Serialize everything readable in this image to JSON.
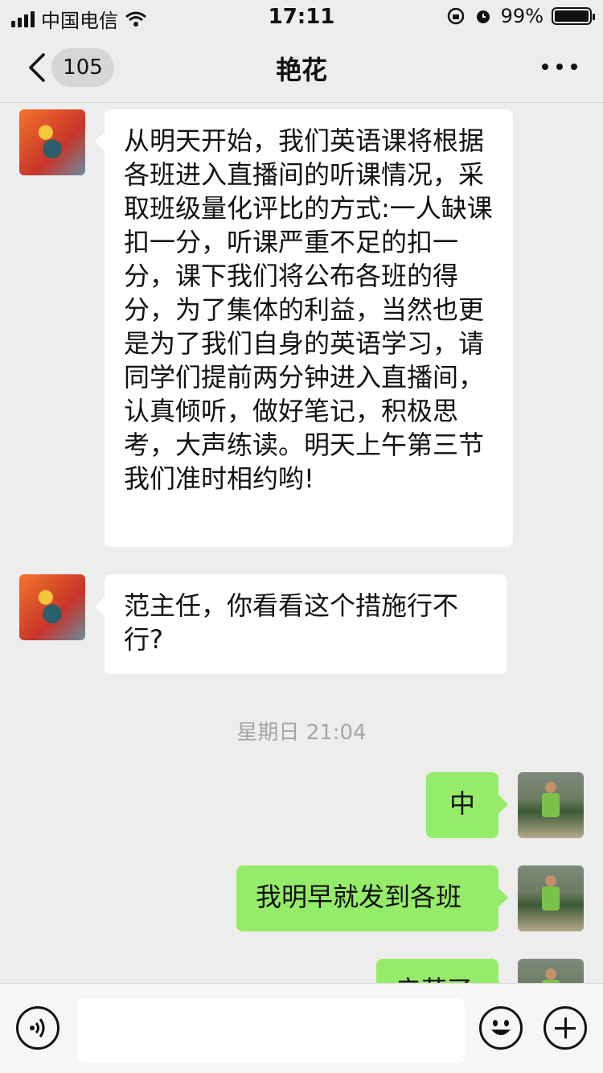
{
  "status_bar": {
    "carrier": "中国电信",
    "time": "17:11",
    "battery": "99%",
    "battery_level": 0.99
  },
  "header": {
    "back_badge": "105",
    "title": "艳花",
    "icons": [
      "chevron-left-icon",
      "more-icon"
    ]
  },
  "messages": [
    {
      "side": "left",
      "avatar": "sender-avatar",
      "text": "从明天开始，我们英语课将根据各班进入直播间的听课情况，采取班级量化评比的方式:一人缺课扣一分，听课严重不足的扣一分，课下我们将公布各班的得分，为了集体的利益，当然也更是为了我们自身的英语学习，请同学们提前两分钟进入直播间，认真倾听，做好笔记，积极思考，大声练读。明天上午第三节我们准时相约哟!"
    },
    {
      "side": "left",
      "avatar": "sender-avatar",
      "text": "范主任，你看看这个措施行不行?"
    },
    {
      "type": "timestamp",
      "text": "星期日 21:04"
    },
    {
      "side": "right",
      "avatar": "self-avatar",
      "text": "中"
    },
    {
      "side": "right",
      "avatar": "self-avatar",
      "text": "我明早就发到各班"
    },
    {
      "side": "right",
      "avatar": "self-avatar",
      "text": "辛苦了"
    }
  ],
  "input_bar": {
    "value": "",
    "icons": [
      "voice-icon",
      "emoji-icon",
      "plus-icon"
    ]
  },
  "colors": {
    "background": "#ededed",
    "bubble_in": "#ffffff",
    "bubble_out": "#95ec69",
    "timestamp": "#a6a6a6"
  }
}
